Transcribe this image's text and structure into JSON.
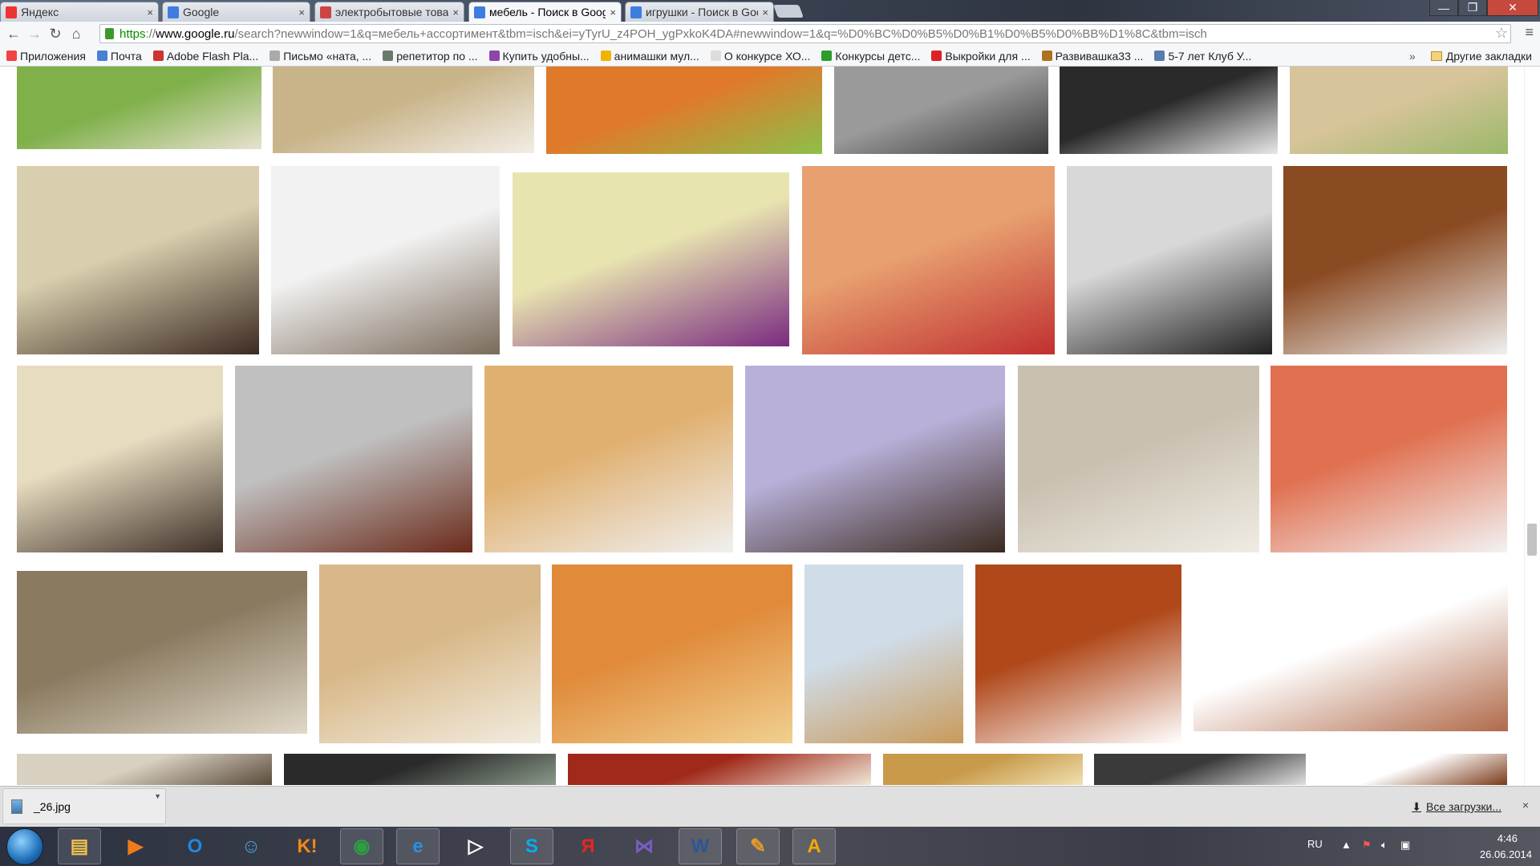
{
  "browser": {
    "tabs": [
      {
        "title": "Яндекс",
        "favicon": "yandex-icon",
        "active": false
      },
      {
        "title": "Google",
        "favicon": "google-icon",
        "active": false
      },
      {
        "title": "электробытовые товары",
        "favicon": "image-icon",
        "active": false
      },
      {
        "title": "мебель - Поиск в Google",
        "favicon": "google-icon",
        "active": true
      },
      {
        "title": "игрушки - Поиск в Google",
        "favicon": "google-icon",
        "active": false
      }
    ],
    "close_glyph": "×",
    "window_controls": {
      "minimize": "—",
      "maximize": "❐",
      "close": "✕"
    },
    "url": {
      "scheme": "https",
      "sep": "://",
      "host": "www.google.ru",
      "rest": "/search?newwindow=1&q=мебель+ассортимент&tbm=isch&ei=yTyrU_z4POH_ygPxkoK4DA#newwindow=1&q=%D0%BC%D0%B5%D0%B1%D0%B5%D0%BB%D1%8C&tbm=isch"
    },
    "nav": {
      "back": "←",
      "forward": "→",
      "reload": "↻",
      "home": "⌂",
      "star": "☆",
      "menu": "≡"
    }
  },
  "bookmarks": {
    "items": [
      {
        "label": "Приложения",
        "color": "#e44"
      },
      {
        "label": "Почта",
        "color": "#4a7fd6"
      },
      {
        "label": "Adobe Flash Pla...",
        "color": "#c33"
      },
      {
        "label": "Письмо «ната, ...",
        "color": "#aaa"
      },
      {
        "label": "репетитор по ...",
        "color": "#6a7a6a"
      },
      {
        "label": "Купить удобны...",
        "color": "#8e44ad"
      },
      {
        "label": "анимашки мул...",
        "color": "#f0b400"
      },
      {
        "label": "О конкурсе  ХО...",
        "color": "#ddd"
      },
      {
        "label": "Конкурсы детс...",
        "color": "#2a9d2a"
      },
      {
        "label": "Выкройки для ...",
        "color": "#d22"
      },
      {
        "label": "Развивашка33 ...",
        "color": "#b07020"
      },
      {
        "label": "5-7 лет  Клуб У...",
        "color": "#5a7ab0"
      }
    ],
    "overflow": "»",
    "other": "Другие закладки"
  },
  "downloads": {
    "file": "_26.jpg",
    "all_label": "Все загрузки...",
    "close": "×"
  },
  "taskbar": {
    "apps": [
      {
        "name": "explorer",
        "glyph": "▤",
        "color": "#f2c14e"
      },
      {
        "name": "media-player",
        "glyph": "▶",
        "color": "#f07a1a"
      },
      {
        "name": "opera",
        "glyph": "O",
        "color": "#1e88e5"
      },
      {
        "name": "qip",
        "glyph": "☺",
        "color": "#4aa3df"
      },
      {
        "name": "odnoklassniki",
        "glyph": "K!",
        "color": "#f28a16"
      },
      {
        "name": "chrome",
        "glyph": "◉",
        "color": "#2ea043"
      },
      {
        "name": "internet-explorer",
        "glyph": "e",
        "color": "#2a8fe0"
      },
      {
        "name": "video-app",
        "glyph": "▷",
        "color": "#ffffff"
      },
      {
        "name": "skype",
        "glyph": "S",
        "color": "#00aff0"
      },
      {
        "name": "yandex-browser",
        "glyph": "Я",
        "color": "#e52620"
      },
      {
        "name": "visual-studio",
        "glyph": "⋈",
        "color": "#7b5cc4"
      },
      {
        "name": "word",
        "glyph": "W",
        "color": "#2b5797"
      },
      {
        "name": "paint-app",
        "glyph": "✎",
        "color": "#e89a2a"
      },
      {
        "name": "aimp",
        "glyph": "A",
        "color": "#f5a800"
      }
    ],
    "lang": "RU",
    "time": "4:46",
    "date": "26.06.2014"
  }
}
